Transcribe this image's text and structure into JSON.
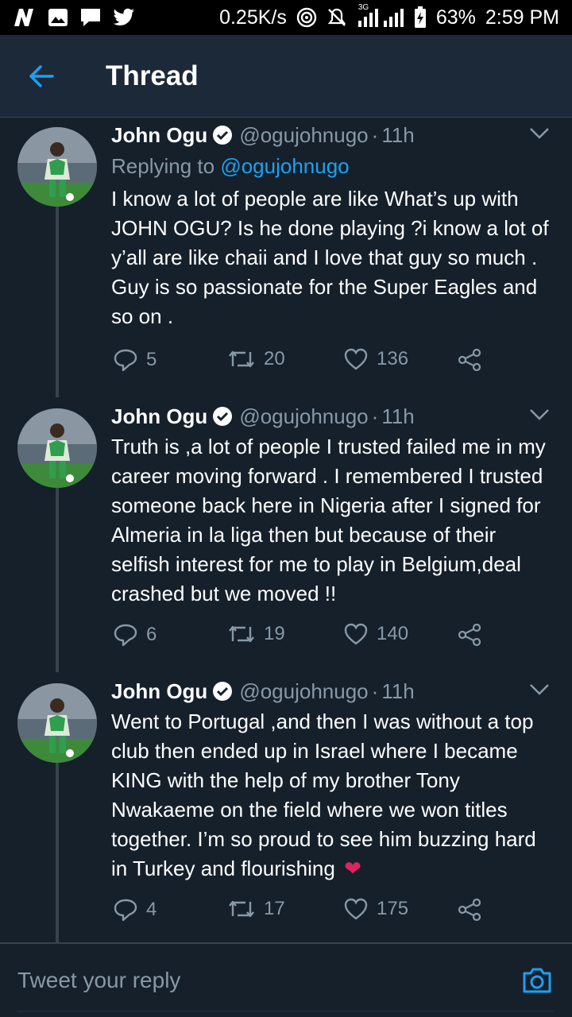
{
  "status_bar": {
    "speed": "0.25K/s",
    "network": "3G",
    "battery": "63%",
    "time": "2:59 PM"
  },
  "header": {
    "title": "Thread",
    "back_icon": "arrow-left-icon"
  },
  "tweets": [
    {
      "name": "John Ogu",
      "handle": "@ogujohnugo",
      "sep": "·",
      "time": "11h",
      "replying_prefix": "Replying to",
      "replying_to": "@ogujohnugo",
      "text": "I know a lot of people are like What’s up with JOHN OGU? Is he done playing ?i know a lot of y’all are like chaii and I love that guy so much . Guy is so passionate for the Super Eagles and so on .",
      "replies": "5",
      "retweets": "20",
      "likes": "136"
    },
    {
      "name": "John Ogu",
      "handle": "@ogujohnugo",
      "sep": "·",
      "time": "11h",
      "text": "Truth is ,a lot of people I trusted failed me in my career moving forward . I remembered I trusted someone back here in Nigeria after I signed for Almeria in la liga then but because of their selfish interest for me to play in Belgium,deal crashed but we moved !!",
      "replies": "6",
      "retweets": "19",
      "likes": "140"
    },
    {
      "name": "John Ogu",
      "handle": "@ogujohnugo",
      "sep": "·",
      "time": "11h",
      "text": "Went to Portugal ,and then I was without a top club then ended up in Israel where I became KING with the help of my brother Tony Nwakaeme on the field where we won titles together. I’m so proud to see him buzzing hard in Turkey and flourishing",
      "emoji": "❤",
      "replies": "4",
      "retweets": "17",
      "likes": "175"
    }
  ],
  "reply_bar": {
    "placeholder": "Tweet your reply",
    "camera_icon": "camera-icon"
  },
  "colors": {
    "background": "#15202b",
    "accent": "#1da1f2",
    "muted": "#8899a6",
    "heart": "#e0245e"
  }
}
